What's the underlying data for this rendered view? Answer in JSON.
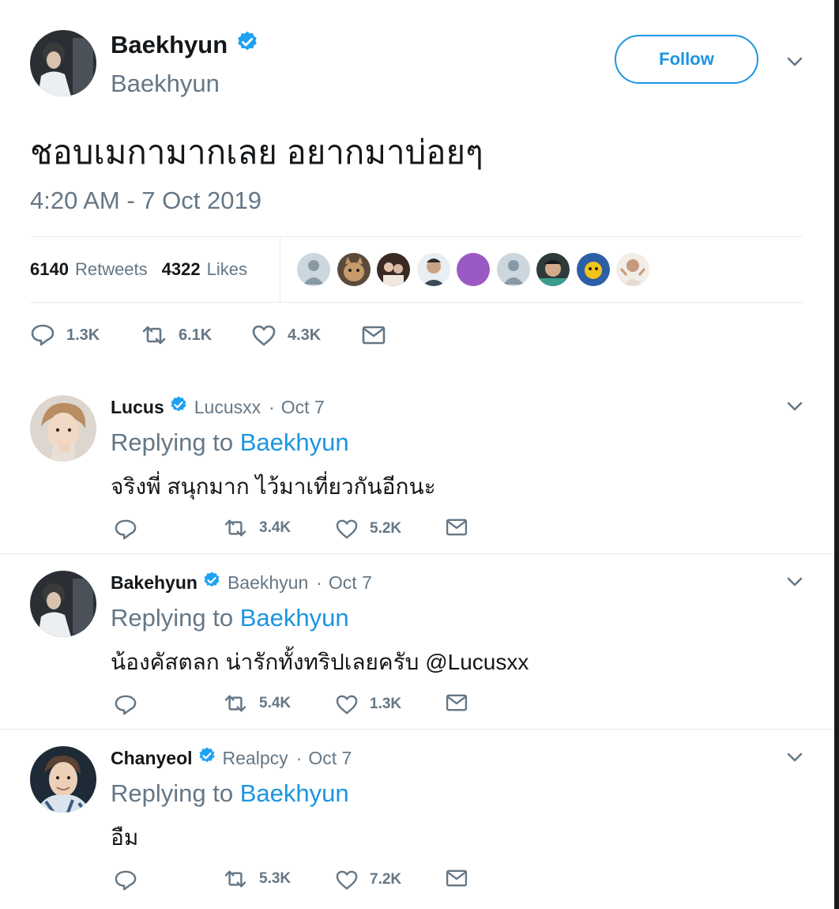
{
  "main_tweet": {
    "author_name": "Baekhyun",
    "author_handle": "Baekhyun",
    "follow_label": "Follow",
    "text": "ชอบเมกามากเลย อยากมาบ่อยๆ",
    "timestamp": "4:20 AM - 7 Oct 2019",
    "retweets_count": "6140",
    "retweets_label": "Retweets",
    "likes_count": "4322",
    "likes_label": "Likes",
    "actions": {
      "replies": "1.3K",
      "retweets": "6.1K",
      "likes": "4.3K"
    }
  },
  "replies": [
    {
      "name": "Lucus",
      "handle": "Lucusxx",
      "date": "Oct 7",
      "replying_prefix": "Replying to",
      "replying_to": "Baekhyun",
      "text": "จริงพี่ สนุกมาก ไว้มาเที่ยวกันอีกนะ",
      "retweets": "3.4K",
      "likes": "5.2K"
    },
    {
      "name": "Bakehyun",
      "handle": "Baekhyun",
      "date": "Oct 7",
      "replying_prefix": "Replying to",
      "replying_to": "Baekhyun",
      "text": "น้องคัสตลก น่ารักทั้งทริปเลยครับ @Lucusxx",
      "retweets": "5.4K",
      "likes": "1.3K"
    },
    {
      "name": "Chanyeol",
      "handle": "Realpcy",
      "date": "Oct 7",
      "replying_prefix": "Replying to",
      "replying_to": "Baekhyun",
      "text": "อืม",
      "retweets": "5.3K",
      "likes": "7.2K"
    }
  ],
  "colors": {
    "accent": "#1b95e0",
    "verified": "#1da1f2",
    "muted": "#657786",
    "text": "#14171a",
    "divider": "#e6ecf0"
  }
}
